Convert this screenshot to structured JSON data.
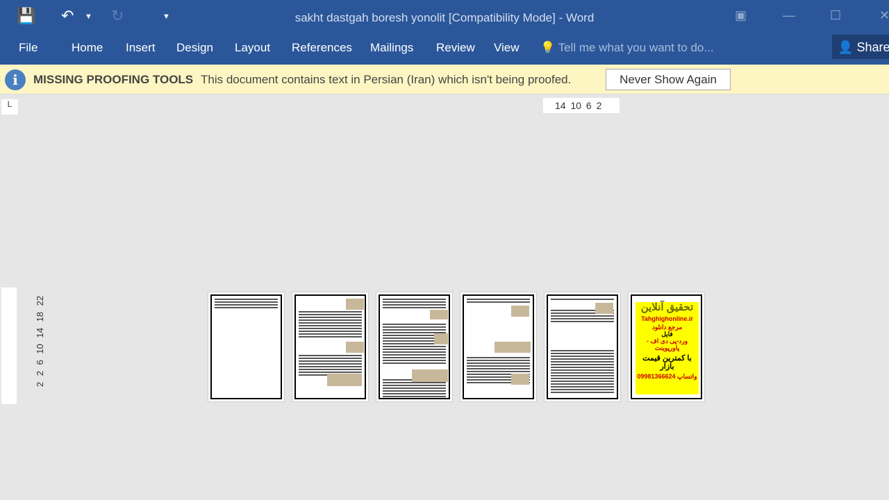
{
  "window": {
    "title": "sakht dastgah boresh yonolit [Compatibility Mode] - Word"
  },
  "quick_access": {
    "save_icon": "floppy-disk",
    "undo_icon": "undo-arrow",
    "redo_icon": "redo-arrow",
    "customize_icon": "dropdown"
  },
  "ribbon": {
    "tabs": [
      "File",
      "Home",
      "Insert",
      "Design",
      "Layout",
      "References",
      "Mailings",
      "Review",
      "View"
    ],
    "tell_me": "Tell me what you want to do...",
    "share": "Share"
  },
  "message_bar": {
    "title": "MISSING PROOFING TOOLS",
    "message": "This document contains text in Persian (Iran) which isn't being proofed.",
    "button": "Never Show Again"
  },
  "rulers": {
    "horizontal": "14 10 6 2",
    "vertical": "2 2 6 10 14 18 22",
    "tab_selector": "L"
  },
  "ad_page": {
    "line1": "تحقیق آنلاین",
    "line2": "Tahghighonline.ir",
    "line3": "مرجع دانلود",
    "line4": "فایل",
    "line5": "ورد-پی دی اف - پاورپوینت",
    "line6": "با کمترین قیمت بازار",
    "line7": "09981366624 واتساپ"
  },
  "colors": {
    "ribbon": "#2b579a",
    "message_bar": "#fdf6c3",
    "ad_background": "#ffff00"
  }
}
